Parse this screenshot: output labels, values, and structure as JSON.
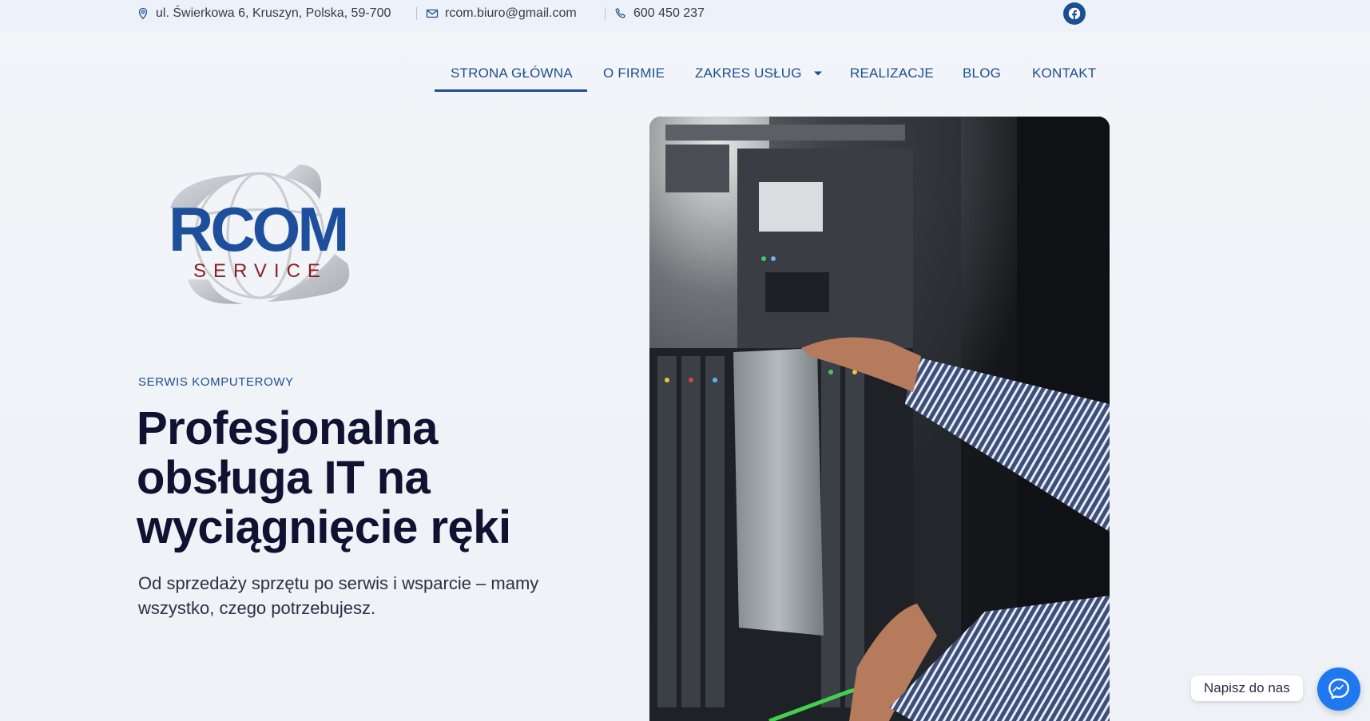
{
  "topbar": {
    "address": "ul. Świerkowa 6, Kruszyn, Polska, 59-700",
    "email": "rcom.biuro@gmail.com",
    "phone": "600 450 237",
    "social_icon": "facebook-icon"
  },
  "nav": {
    "items": [
      {
        "label": "STRONA GŁÓWNA",
        "active": true
      },
      {
        "label": "O FIRMIE"
      },
      {
        "label": "ZAKRES USŁUG",
        "has_dropdown": true
      },
      {
        "label": "REALIZACJE"
      },
      {
        "label": "BLOG"
      },
      {
        "label": "KONTAKT"
      }
    ]
  },
  "logo": {
    "main": "RCOM",
    "sub": "SERVICE"
  },
  "hero": {
    "eyebrow": "SERWIS KOMPUTEROWY",
    "headline_line1": "Profesjonalna",
    "headline_line2": "obsługa IT na",
    "headline_line3": "wyciągnięcie ręki",
    "subline": "Od sprzedaży sprzętu po serwis i wsparcie – mamy wszystko, czego potrzebujesz."
  },
  "chat": {
    "label": "Napisz do nas",
    "icon": "messenger-icon"
  },
  "colors": {
    "brand_blue": "#1b4f93",
    "logo_red": "#8e1d22",
    "headline": "#0f1230",
    "messenger": "#1e78f0"
  }
}
